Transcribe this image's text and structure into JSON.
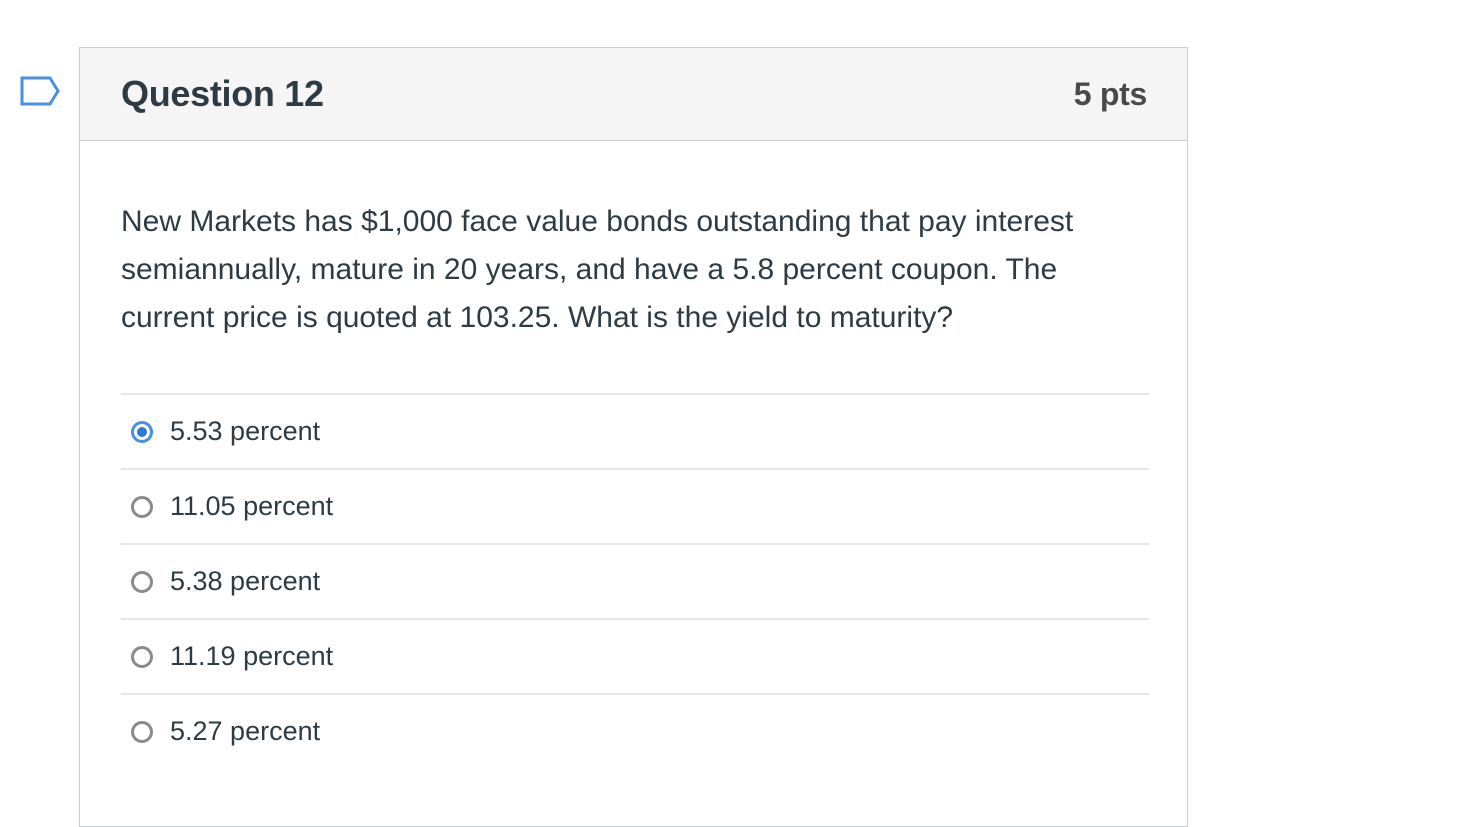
{
  "question": {
    "title": "Question 12",
    "points": "5 pts",
    "text": "New Markets has $1,000 face value bonds outstanding that pay interest semiannually, mature in 20 years, and have a 5.8 percent coupon. The current price is quoted at 103.25. What is the yield to maturity?",
    "flag_icon": "bookmark-flag-icon"
  },
  "answers": [
    {
      "label": "5.53 percent",
      "selected": true
    },
    {
      "label": "11.05 percent",
      "selected": false
    },
    {
      "label": "5.38 percent",
      "selected": false
    },
    {
      "label": "11.19 percent",
      "selected": false
    },
    {
      "label": "5.27 percent",
      "selected": false
    }
  ],
  "colors": {
    "accent": "#2b7cd3",
    "header_bg": "#f5f5f5",
    "text": "#2d3b45"
  }
}
